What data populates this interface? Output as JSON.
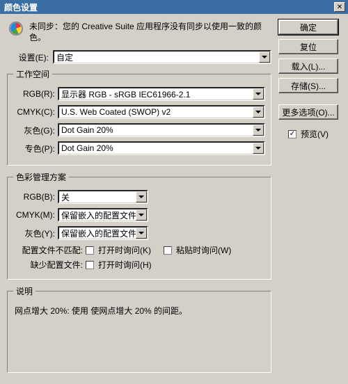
{
  "titlebar": {
    "title": "颜色设置"
  },
  "sync_message": "未同步：您的 Creative Suite 应用程序没有同步以使用一致的颜色。",
  "settings_label": "设置(E):",
  "settings_value": "自定",
  "workspace": {
    "legend": "工作空间",
    "rgb_label": "RGB(R):",
    "rgb_value": "显示器 RGB - sRGB IEC61966-2.1",
    "cmyk_label": "CMYK(C):",
    "cmyk_value": "U.S. Web Coated (SWOP) v2",
    "gray_label": "灰色(G):",
    "gray_value": "Dot Gain 20%",
    "spot_label": "专色(P):",
    "spot_value": "Dot Gain 20%"
  },
  "policies": {
    "legend": "色彩管理方案",
    "rgb_label": "RGB(B):",
    "rgb_value": "关",
    "cmyk_label": "CMYK(M):",
    "cmyk_value": "保留嵌入的配置文件",
    "gray_label": "灰色(Y):",
    "gray_value": "保留嵌入的配置文件",
    "mismatch_label": "配置文件不匹配:",
    "mismatch_open": "打开时询问(K)",
    "mismatch_paste": "粘贴时询问(W)",
    "missing_label": "缺少配置文件:",
    "missing_open": "打开时询问(H)"
  },
  "description": {
    "legend": "说明",
    "text": "网点增大 20%: 使用 使网点增大 20% 的间距。"
  },
  "buttons": {
    "ok": "确定",
    "reset": "复位",
    "load": "载入(L)...",
    "save": "存储(S)...",
    "more": "更多选项(O)..."
  },
  "preview_label": "预览(V)"
}
